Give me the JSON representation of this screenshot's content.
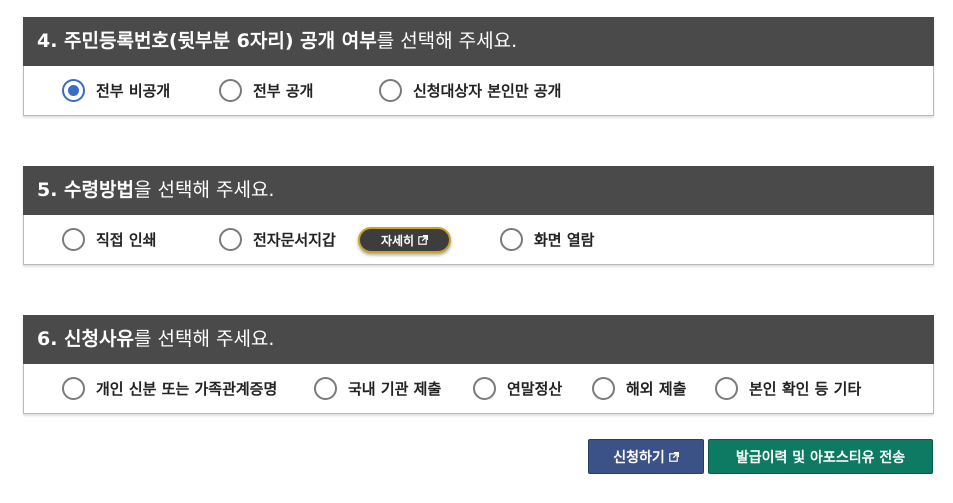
{
  "section4": {
    "title_strong": "4. 주민등록번호(뒷부분 6자리) 공개 여부",
    "title_rest": "를 선택해 주세요.",
    "options": [
      {
        "label": "전부 비공개",
        "checked": true
      },
      {
        "label": "전부 공개",
        "checked": false
      },
      {
        "label": "신청대상자 본인만 공개",
        "checked": false
      }
    ]
  },
  "section5": {
    "title_strong": "5. 수령방법",
    "title_rest": "을 선택해 주세요.",
    "options": [
      {
        "label": "직접 인쇄",
        "checked": false
      },
      {
        "label": "전자문서지갑",
        "checked": false
      },
      {
        "label": "화면 열람",
        "checked": false
      }
    ],
    "detail_button": "자세히"
  },
  "section6": {
    "title_strong": "6. 신청사유",
    "title_rest": "를 선택해 주세요.",
    "options": [
      {
        "label": "개인 신분 또는 가족관계증명",
        "checked": false
      },
      {
        "label": "국내 기관 제출",
        "checked": false
      },
      {
        "label": "연말정산",
        "checked": false
      },
      {
        "label": "해외 제출",
        "checked": false
      },
      {
        "label": "본인 확인 등 기타",
        "checked": false
      }
    ]
  },
  "actions": {
    "apply": "신청하기",
    "history": "발급이력 및 아포스티유 전송"
  },
  "colors": {
    "header_bg": "#4a4a4a",
    "radio_checked": "#3c6bc6",
    "apply_bg": "#3a5286",
    "history_bg": "#0f7a63",
    "detail_border": "#c9a227"
  }
}
